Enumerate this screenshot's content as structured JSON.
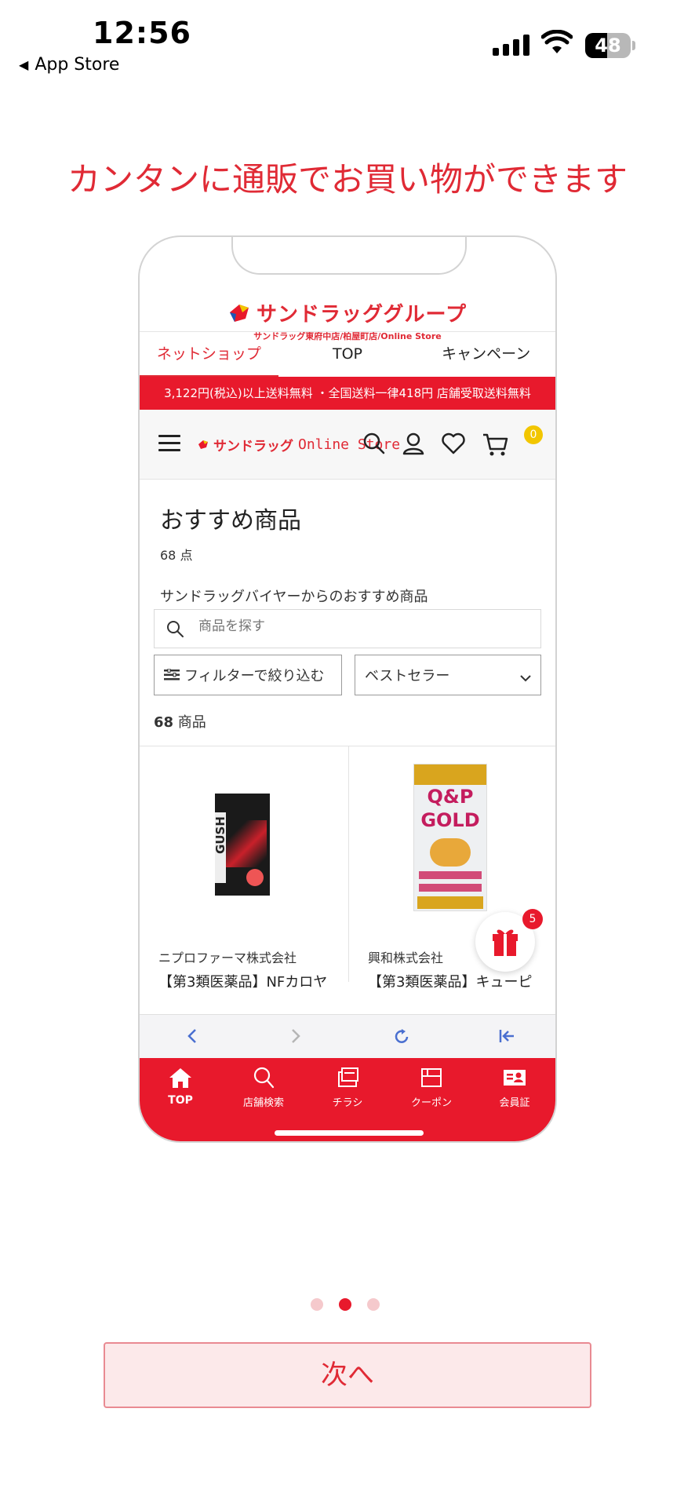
{
  "status_bar": {
    "time": "12:56",
    "back_label": "App Store",
    "battery": "48",
    "battery_level": 0.48
  },
  "headline": "カンタンに通販でお買い物ができます",
  "mockup": {
    "logo_title": "サンドラッググループ",
    "logo_subtitle": "サンドラッグ東府中店/柏屋町店/Online Store",
    "tabs": [
      {
        "label": "ネットショップ",
        "active": true
      },
      {
        "label": "TOP",
        "active": false
      },
      {
        "label": "キャンペーン",
        "active": false
      }
    ],
    "banner": "3,122円(税込)以上送料無料 ・全国送料一律418円 店舗受取送料無料",
    "store_logo_brand": "サンドラッグ",
    "store_logo_suffix": "Online Store",
    "cart_count": "0",
    "page_title": "おすすめ商品",
    "item_count": "68 点",
    "section_subtitle": "サンドラッグバイヤーからのおすすめ商品",
    "search_placeholder": "商品を探す",
    "filter_label": "フィルターで絞り込む",
    "sort_label": "ベストセラー",
    "product_count_num": "68",
    "product_count_unit": "商品",
    "products": [
      {
        "maker": "ニプロファーマ株式会社",
        "name": "【第3類医薬品】NFカロヤ",
        "package_text": "GUSH"
      },
      {
        "maker": "興和株式会社",
        "name": "【第3類医薬品】キューピ",
        "package_text": "Q&P GOLD α"
      }
    ],
    "gift_count": "5",
    "tabbar": [
      {
        "label": "TOP",
        "icon": "home-icon",
        "active": true
      },
      {
        "label": "店舗検索",
        "icon": "search-icon",
        "active": false
      },
      {
        "label": "チラシ",
        "icon": "flyer-icon",
        "active": false
      },
      {
        "label": "クーポン",
        "icon": "coupon-icon",
        "active": false
      },
      {
        "label": "会員証",
        "icon": "member-card-icon",
        "active": false
      }
    ]
  },
  "pager": {
    "total": 3,
    "current": 2
  },
  "next_button": "次へ",
  "colors": {
    "brand_red": "#e8192c",
    "headline_red": "#e02a35",
    "badge_yellow": "#f2c600"
  }
}
